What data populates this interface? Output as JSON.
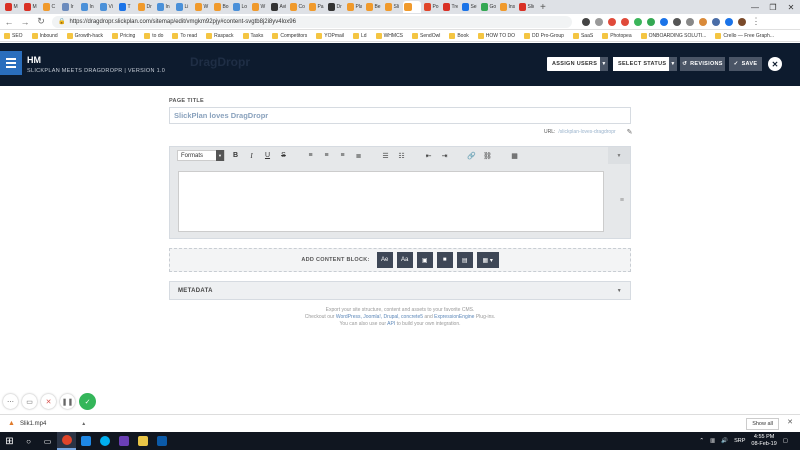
{
  "browser": {
    "tabs": [
      {
        "label": "M",
        "color": "#d93025"
      },
      {
        "label": "M",
        "color": "#d93025"
      },
      {
        "label": "C",
        "color": "#f09a2c"
      },
      {
        "label": "Ir",
        "color": "#6b8bbd"
      },
      {
        "label": "In",
        "color": "#4a90d9"
      },
      {
        "label": "Vi",
        "color": "#4a90d9"
      },
      {
        "label": "T",
        "color": "#1a73e8"
      },
      {
        "label": "Dr",
        "color": "#f09a2c"
      },
      {
        "label": "In",
        "color": "#4a90d9"
      },
      {
        "label": "Li",
        "color": "#4a90d9"
      },
      {
        "label": "W",
        "color": "#f09a2c"
      },
      {
        "label": "Bo",
        "color": "#f09a2c"
      },
      {
        "label": "Lo",
        "color": "#4a90d9"
      },
      {
        "label": "W",
        "color": "#f09a2c"
      },
      {
        "label": "Avi",
        "color": "#333333"
      },
      {
        "label": "Co",
        "color": "#f09a2c"
      },
      {
        "label": "Pa",
        "color": "#f09a2c"
      },
      {
        "label": "Dr",
        "color": "#333333"
      },
      {
        "label": "Pla",
        "color": "#f09a2c"
      },
      {
        "label": "Be",
        "color": "#f09a2c"
      },
      {
        "label": "Sli",
        "color": "#f09a2c"
      },
      {
        "label": "",
        "color": "#f09a2c",
        "active": true
      },
      {
        "label": "Po",
        "color": "#e0452a"
      },
      {
        "label": "Tre",
        "color": "#d93025"
      },
      {
        "label": "Sel",
        "color": "#1a73e8"
      },
      {
        "label": "Go",
        "color": "#34a853"
      },
      {
        "label": "Ins",
        "color": "#f09a2c"
      },
      {
        "label": "Slic",
        "color": "#d93025"
      }
    ],
    "new_tab": "+",
    "window_controls": {
      "minimize": "—",
      "maximize": "❐",
      "close": "✕"
    },
    "url": "https://dragdropr.slickplan.com/sitemap/edit/vmgkm92pjy#content-svgtb8j2i8yv4lox96",
    "bookmarks": [
      "SEO",
      "Inbound",
      "Growth-hack",
      "Pricing",
      "to do",
      "To read",
      "Raspack",
      "Tasks",
      "Competitors",
      "YOPmail",
      "Ld",
      "WHMCS",
      "SendOwl",
      "Book",
      "HOW TO DO",
      "DD Pro-Group",
      "SaaS",
      "Photopea",
      "ONBOARDING SOLUTI...",
      "Crello — Free Graph..."
    ]
  },
  "header": {
    "title": "HM",
    "subtitle": "SLICKPLAN MEETS DRAGDROPR | VERSION 1.0",
    "watermark": "DragDropr",
    "assign_users": "ASSIGN USERS",
    "select_status": "SELECT STATUS",
    "revisions": "REVISIONS",
    "save": "SAVE",
    "close": "✕"
  },
  "editor": {
    "page_title_label": "PAGE TITLE",
    "page_title_value": "SlickPlan loves DragDropr",
    "url_label": "URL:",
    "url_value": "/slickplan-loves-dragdropr",
    "formats_label": "Formats",
    "add_content_block_label": "ADD CONTENT BLOCK:",
    "metadata_label": "METADATA"
  },
  "export_note": {
    "line1": "Export your site structure, content and assets to your favorite CMS.",
    "line2_prefix": "Checkout our",
    "links": "WordPress, Joomla!, Drupal, concrete5",
    "and": "and",
    "link_ee": "ExpressionEngine",
    "line2_suffix": "Plug-ins.",
    "line3_prefix": "You can also use our",
    "link_api": "API",
    "line3_suffix": "to build your own integration."
  },
  "downloads": {
    "file": "Slik1.mp4",
    "show_all": "Show all"
  },
  "taskbar": {
    "lang": "SRP",
    "time": "4:55 PM",
    "date": "08-Feb-19"
  }
}
